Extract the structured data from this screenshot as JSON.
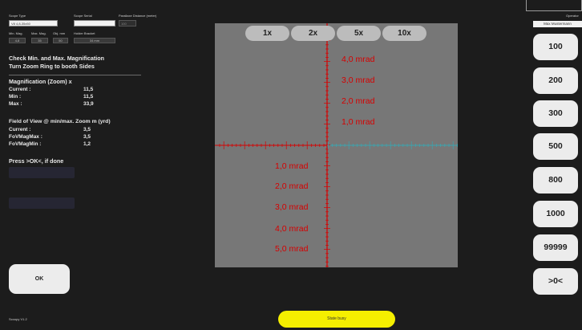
{
  "top": {
    "scope_type_label": "Scope Type",
    "scope_type_value": "V8 4,8-35x50",
    "scope_serial_label": "Scope Serial",
    "scope_serial_value": "",
    "parallax_label": "Parallaxe Distance (meter)",
    "parallax_value": "100"
  },
  "specs": {
    "min_mag_label": "Min. Mag.",
    "min_mag_value": "4,8",
    "max_mag_label": "Max. Mag.",
    "max_mag_value": "35",
    "obj_mm_label": "Obj. mm",
    "obj_mm_value": "50",
    "holder_label": "Holder Bracket",
    "holder_value": "34 mm"
  },
  "instructions": {
    "line1": "Check Min. and Max. Magnification",
    "line2": "Turn Zoom Ring to booth Sides",
    "press_ok": "Press >OK<, if done"
  },
  "magnification": {
    "heading": "Magnification (Zoom) x",
    "rows": [
      {
        "label": "Current :",
        "value": "11,5"
      },
      {
        "label": "Min :",
        "value": "11,5"
      },
      {
        "label": "Max :",
        "value": "33,9"
      }
    ]
  },
  "fov": {
    "heading": "Field of View @ min/max. Zoom m (yrd)",
    "rows": [
      {
        "label": "Current :",
        "value": "3,5"
      },
      {
        "label": "FoVMagMax :",
        "value": "3,5"
      },
      {
        "label": "FoVMagMin :",
        "value": "1,2"
      }
    ]
  },
  "zoom_buttons": [
    "1x",
    "2x",
    "5x",
    "10x"
  ],
  "mrad_labels": {
    "upper": [
      "4,0 mrad",
      "3,0 mrad",
      "2,0 mrad",
      "1,0 mrad"
    ],
    "lower": [
      "1,0 mrad",
      "2,0 mrad",
      "3,0 mrad",
      "4,0 mrad",
      "5,0 mrad"
    ]
  },
  "operator": {
    "label": "Operator",
    "value": "Max Mustermann"
  },
  "distance_buttons": [
    "100",
    "200",
    "300",
    "500",
    "800",
    "1000",
    "99999",
    ">0<"
  ],
  "ok_button": "OK",
  "state": "State busy",
  "version": "Scoopy V1.2",
  "colors": {
    "background": "#1c1c1c",
    "scope_view": "#777777",
    "reticle": "#d60000",
    "crosshair_right": "#3aa6b0",
    "state_badge": "#f5ef00"
  }
}
